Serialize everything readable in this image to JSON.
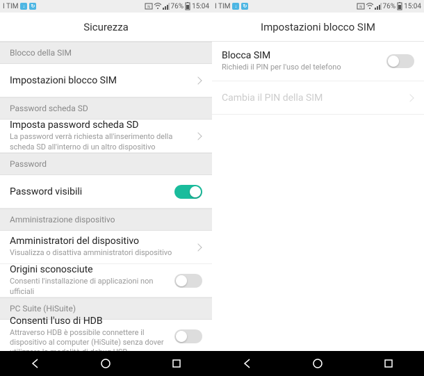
{
  "status": {
    "carrier": "I TIM",
    "signal_percent": "76%",
    "time": "15:04"
  },
  "left": {
    "header": "Sicurezza",
    "sections": {
      "sim": {
        "header": "Blocco della SIM",
        "lock_settings": "Impostazioni blocco SIM"
      },
      "sd": {
        "header": "Password scheda SD",
        "set_pwd": "Imposta password scheda SD",
        "set_pwd_sub": "La password verrà richiesta all'inserimento della scheda SD all'interno di un altro dispositivo"
      },
      "pwd": {
        "header": "Password",
        "visible": "Password visibili"
      },
      "admin": {
        "header": "Amministrazione dispositivo",
        "admins": "Amministratori del dispositivo",
        "admins_sub": "Visualizza o disattiva amministratori dispositivo",
        "unknown": "Origini sconosciute",
        "unknown_sub": "Consenti l'installazione di applicazioni non ufficiali"
      },
      "hisuite": {
        "header": "PC Suite (HiSuite)",
        "hdb": "Consenti l'uso di HDB",
        "hdb_sub": "Attraverso HDB è possibile connettere il dispositivo al computer (HiSuite) senza dover utilizzare la modalità di debug USB"
      }
    }
  },
  "right": {
    "header": "Impostazioni blocco SIM",
    "lock_sim": "Blocca SIM",
    "lock_sim_sub": "Richiedi il PIN per l'uso del telefono",
    "change_pin": "Cambia il PIN della SIM"
  }
}
